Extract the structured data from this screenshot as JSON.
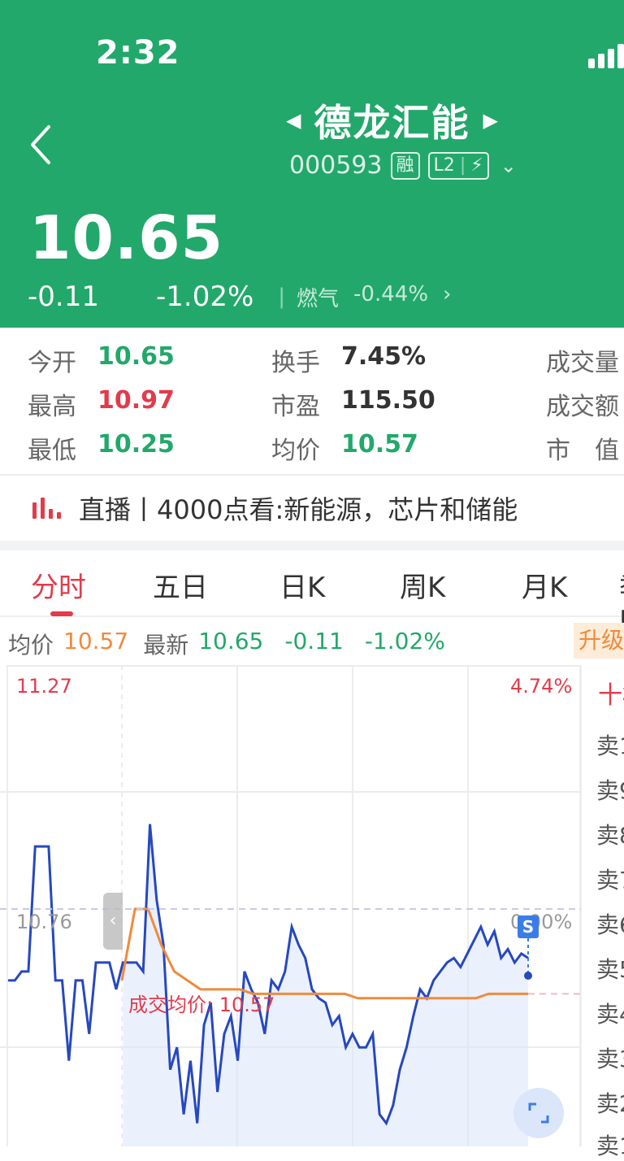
{
  "status_bar": {
    "time": "2:32"
  },
  "header": {
    "stock_name": "德龙汇能",
    "code": "000593",
    "badge_margin": "融",
    "badge_l2": "L2",
    "price": "10.65",
    "change": "-0.11",
    "change_pct": "-1.02%",
    "sector_name": "燃气",
    "sector_pct": "-0.44%",
    "bg_color": "#22a86b"
  },
  "stats": {
    "open": {
      "label": "今开",
      "value": "10.65"
    },
    "high": {
      "label": "最高",
      "value": "10.97"
    },
    "low": {
      "label": "最低",
      "value": "10.25"
    },
    "turnover": {
      "label": "换手",
      "value": "7.45%"
    },
    "pe": {
      "label": "市盈",
      "value": "115.50"
    },
    "avg": {
      "label": "均价",
      "value": "10.57"
    },
    "volume_label": "成交量",
    "amount_label": "成交额",
    "mktcap_label": "市　值"
  },
  "live": {
    "text": "直播丨4000点看:新能源，芯片和储能"
  },
  "tabs": [
    "分时",
    "五日",
    "日K",
    "周K",
    "月K",
    "季K"
  ],
  "active_tab": "分时",
  "chart_info": {
    "avg_label": "均价",
    "avg_value": "10.57",
    "last_label": "最新",
    "last_value": "10.65",
    "change": "-0.11",
    "change_pct": "-1.02%",
    "upgrade": "升级"
  },
  "chart_data": {
    "type": "line",
    "y_max_label": "11.27",
    "y_max_pct": "4.74%",
    "y_mid_label": "10.76",
    "y_mid_pct": "0.00%",
    "avg_annotation": "成交均价: 10.57",
    "marker": "S",
    "ylim": [
      10.25,
      11.27
    ],
    "series": [
      {
        "values": [
          10.6,
          10.6,
          10.62,
          10.62,
          10.9,
          10.9,
          10.9,
          10.6,
          10.6,
          10.42,
          10.6,
          10.6,
          10.48,
          10.64,
          10.64,
          10.64,
          10.58,
          10.64,
          10.64,
          10.64,
          10.62,
          10.95,
          10.78,
          10.68,
          10.4,
          10.45,
          10.3,
          10.42,
          10.28,
          10.5,
          10.55,
          10.35,
          10.48,
          10.52,
          10.42,
          10.62,
          10.58,
          10.55,
          10.48,
          10.6,
          10.58,
          10.62,
          10.72,
          10.68,
          10.65,
          10.58,
          10.56,
          10.55,
          10.5,
          10.52,
          10.45,
          10.48,
          10.45,
          10.45,
          10.48,
          10.3,
          10.28,
          10.32,
          10.4,
          10.45,
          10.52,
          10.58,
          10.56,
          10.6,
          10.62,
          10.64,
          10.65,
          10.63,
          10.66,
          10.69,
          10.72,
          10.68,
          10.71,
          10.65,
          10.67,
          10.64,
          10.66,
          10.65
        ]
      },
      {
        "values": [
          10.6,
          10.76,
          10.76,
          10.68,
          10.62,
          10.6,
          10.58,
          10.58,
          10.58,
          10.58,
          10.57,
          10.57,
          10.57,
          10.57,
          10.57,
          10.57,
          10.57,
          10.57,
          10.56,
          10.56,
          10.56,
          10.56,
          10.56,
          10.56,
          10.56,
          10.56,
          10.56,
          10.56,
          10.57,
          10.57,
          10.57,
          10.57
        ]
      }
    ]
  }
}
